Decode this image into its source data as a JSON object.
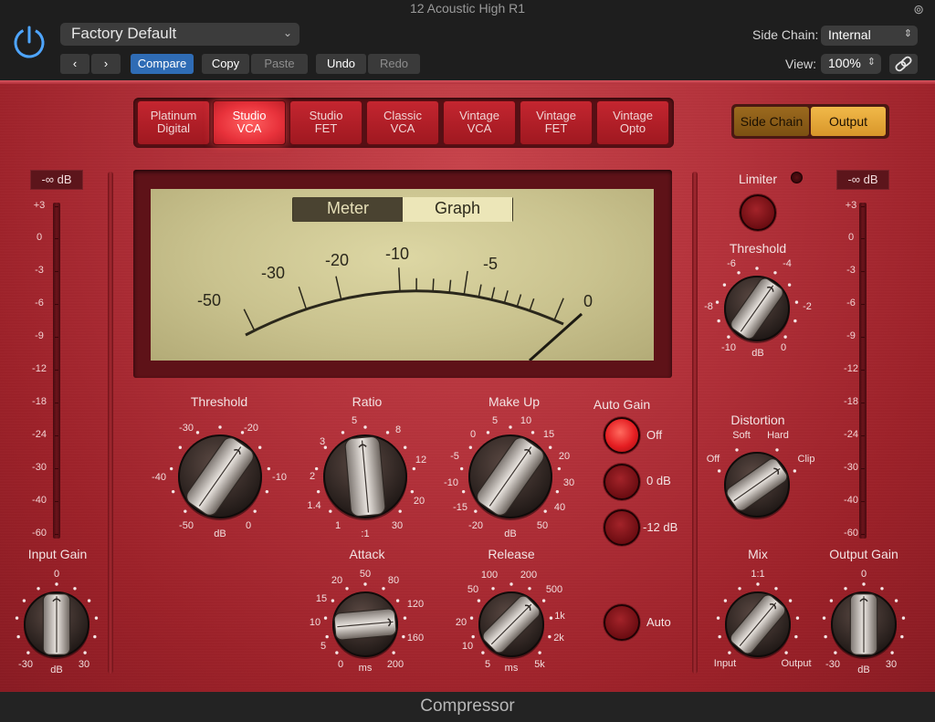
{
  "window": {
    "title": "12 Acoustic High R1"
  },
  "header": {
    "preset": "Factory Default",
    "buttons": {
      "prev": "‹",
      "next": "›",
      "compare": "Compare",
      "copy": "Copy",
      "paste": "Paste",
      "undo": "Undo",
      "redo": "Redo"
    },
    "side_chain_label": "Side Chain:",
    "side_chain_value": "Internal",
    "view_label": "View:",
    "view_value": "100%"
  },
  "models": [
    "Platinum Digital",
    "Studio VCA",
    "Studio FET",
    "Classic VCA",
    "Vintage VCA",
    "Vintage FET",
    "Vintage Opto"
  ],
  "models_lines": [
    [
      "Platinum",
      "Digital"
    ],
    [
      "Studio",
      "VCA"
    ],
    [
      "Studio",
      "FET"
    ],
    [
      "Classic",
      "VCA"
    ],
    [
      "Vintage",
      "VCA"
    ],
    [
      "Vintage",
      "FET"
    ],
    [
      "Vintage",
      "Opto"
    ]
  ],
  "active_model": "Studio VCA",
  "sidechain_buttons": {
    "side_chain": "Side Chain",
    "output": "Output"
  },
  "input_meter": {
    "readout": "-∞ dB",
    "scale": [
      "+3",
      "0",
      "-3",
      "-6",
      "-9",
      "-12",
      "-18",
      "-24",
      "-30",
      "-40",
      "-60"
    ]
  },
  "output_meter": {
    "readout": "-∞ dB",
    "scale": [
      "+3",
      "0",
      "-3",
      "-6",
      "-9",
      "-12",
      "-18",
      "-24",
      "-30",
      "-40",
      "-60"
    ]
  },
  "vu": {
    "tabs": {
      "meter": "Meter",
      "graph": "Graph"
    },
    "active_tab": "Meter",
    "scale": [
      "-50",
      "-30",
      "-20",
      "-10",
      "-5",
      "0"
    ]
  },
  "threshold": {
    "label": "Threshold",
    "scale": [
      "-30",
      "-20",
      "-40",
      "-10",
      "-50",
      "0"
    ],
    "unit": "dB"
  },
  "ratio": {
    "label": "Ratio",
    "scale": [
      "5",
      "8",
      "3",
      "12",
      "2",
      "20",
      "1.4",
      "1",
      "30"
    ],
    "unit": ":1"
  },
  "makeup": {
    "label": "Make Up",
    "scale": [
      "0",
      "5",
      "10",
      "15",
      "-5",
      "20",
      "-10",
      "30",
      "-15",
      "40",
      "-20",
      "50"
    ],
    "unit": "dB"
  },
  "auto_gain": {
    "label": "Auto Gain",
    "options": [
      "Off",
      "0 dB",
      "-12 dB"
    ],
    "selected": "Off"
  },
  "attack": {
    "label": "Attack",
    "scale": [
      "20",
      "50",
      "80",
      "15",
      "120",
      "10",
      "160",
      "5",
      "0",
      "200"
    ],
    "unit": "ms"
  },
  "release": {
    "label": "Release",
    "scale": [
      "100",
      "200",
      "50",
      "500",
      "1k",
      "20",
      "2k",
      "10",
      "5",
      "5k"
    ],
    "unit": "ms"
  },
  "auto": {
    "label": "Auto"
  },
  "limiter": {
    "label": "Limiter"
  },
  "limiter_threshold": {
    "label": "Threshold",
    "scale": [
      "-6",
      "-4",
      "-8",
      "-2",
      "-10",
      "0"
    ],
    "unit": "dB"
  },
  "distortion": {
    "label": "Distortion",
    "options": [
      "Off",
      "Soft",
      "Hard",
      "Clip"
    ]
  },
  "mix": {
    "label": "Mix",
    "scale": [
      "1:1",
      "Input",
      "Output"
    ]
  },
  "input_gain": {
    "label": "Input Gain",
    "scale": [
      "0",
      "-30",
      "30"
    ],
    "unit": "dB"
  },
  "output_gain": {
    "label": "Output Gain",
    "scale": [
      "0",
      "-30",
      "30"
    ],
    "unit": "dB"
  },
  "footer": {
    "title": "Compressor"
  },
  "colors": {
    "accent_blue": "#2f6cb5",
    "output_gold": "#e7a83a",
    "plugin_red": "#b5313a",
    "led_red": "#e51e22"
  }
}
